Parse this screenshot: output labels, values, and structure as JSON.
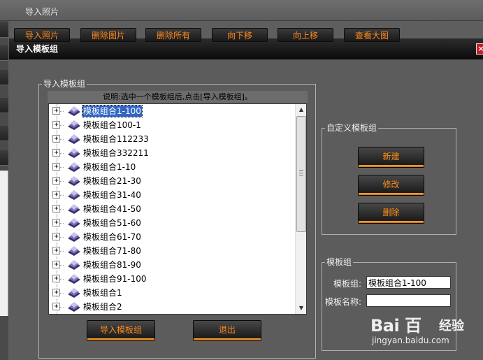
{
  "background_window": {
    "title": "导入照片",
    "toolbar_buttons": [
      "导入照片",
      "删除图片",
      "删除所有",
      "向下移",
      "向上移",
      "查看大图"
    ]
  },
  "dialog": {
    "title": "导入模板组",
    "close_label": "×"
  },
  "import_group": {
    "label": "导入模板组",
    "hint": "说明:选中一个模板组后,点击[导入模板组]。",
    "selected_index": 0,
    "items": [
      "模板组合1-100",
      "模板组合100-1",
      "模板组合112233",
      "模板组合332211",
      "模板组合1-10",
      "模板组合21-30",
      "模板组合31-40",
      "模板组合41-50",
      "模板组合51-60",
      "模板组合61-70",
      "模板组合71-80",
      "模板组合81-90",
      "模板组合91-100",
      "模板组合1",
      "模板组合2"
    ],
    "expander_symbol": "+",
    "import_button": "导入模板组",
    "exit_button": "退出"
  },
  "custom_group": {
    "label": "自定义模板组",
    "new_button": "新建",
    "edit_button": "修改",
    "delete_button": "删除"
  },
  "template_group": {
    "label": "模板组",
    "group_label": "模板组:",
    "group_value": "模板组合1-100",
    "name_label": "模板名称:",
    "name_value": ""
  },
  "watermark": {
    "logo": "Bai 百",
    "text": "经验",
    "url": "jingyan.baidu.com"
  },
  "colors": {
    "accent_orange": "#ff8c1a",
    "selection_blue": "#3166c5",
    "dialog_bg": "#5c5c5c"
  }
}
